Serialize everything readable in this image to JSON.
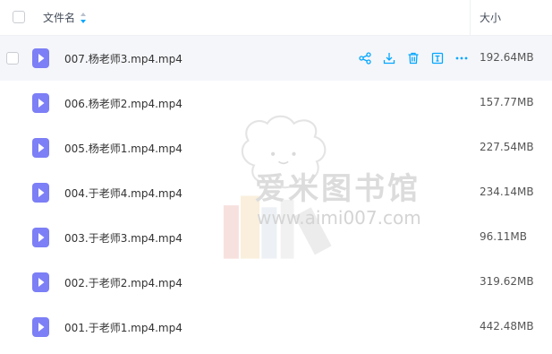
{
  "header": {
    "name_label": "文件名",
    "size_label": "大小"
  },
  "files": [
    {
      "name": "007.杨老师3.mp4.mp4",
      "size": "192.64MB"
    },
    {
      "name": "006.杨老师2.mp4.mp4",
      "size": "157.77MB"
    },
    {
      "name": "005.杨老师1.mp4.mp4",
      "size": "227.54MB"
    },
    {
      "name": "004.于老师4.mp4.mp4",
      "size": "234.14MB"
    },
    {
      "name": "003.于老师3.mp4.mp4",
      "size": "96.11MB"
    },
    {
      "name": "002.于老师2.mp4.mp4",
      "size": "319.62MB"
    },
    {
      "name": "001.于老师1.mp4.mp4",
      "size": "442.48MB"
    }
  ],
  "row_actions": [
    "share-icon",
    "download-icon",
    "delete-icon",
    "rename-icon",
    "more-icon"
  ],
  "watermark": {
    "title": "爱米图书馆",
    "url": "www.aimi007.com"
  },
  "colors": {
    "accent": "#06a7ff",
    "file_icon": "#7c7ff5",
    "hover_row": "#f5f6fa"
  }
}
